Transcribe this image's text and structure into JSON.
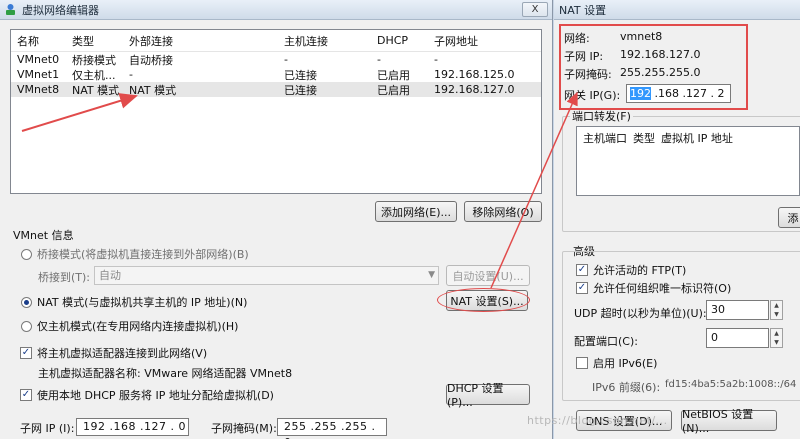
{
  "vne": {
    "title": "虚拟网络编辑器",
    "close_label": "X",
    "list": {
      "headers": [
        "名称",
        "类型",
        "外部连接",
        "主机连接",
        "DHCP",
        "子网地址"
      ],
      "rows": [
        [
          "VMnet0",
          "桥接模式",
          "自动桥接",
          "-",
          "-",
          "-"
        ],
        [
          "VMnet1",
          "仅主机...",
          "-",
          "已连接",
          "已启用",
          "192.168.125.0"
        ],
        [
          "VMnet8",
          "NAT 模式",
          "NAT 模式",
          "已连接",
          "已启用",
          "192.168.127.0"
        ]
      ]
    },
    "add_network": "添加网络(E)...",
    "remove_network": "移除网络(O)",
    "vmnet_info": "VMnet 信息",
    "bridge_mode": "桥接模式(将虚拟机直接连接到外部网络)(B)",
    "bridge_to_label": "桥接到(T):",
    "bridge_to_value": "自动",
    "auto_settings": "自动设置(U)...",
    "nat_mode": "NAT 模式(与虚拟机共享主机的 IP 地址)(N)",
    "nat_settings": "NAT 设置(S)...",
    "host_only_mode": "仅主机模式(在专用网络内连接虚拟机)(H)",
    "connect_adapter": "将主机虚拟适配器连接到此网络(V)",
    "adapter_name": "主机虚拟适配器名称: VMware 网络适配器 VMnet8",
    "use_dhcp": "使用本地 DHCP 服务将 IP 地址分配给虚拟机(D)",
    "dhcp_settings": "DHCP 设置(P)...",
    "subnet_ip_label": "子网 IP (I):",
    "subnet_ip_value": "192 .168 .127 . 0",
    "subnet_mask_label": "子网掩码(M):",
    "subnet_mask_value": "255 .255 .255 . 0"
  },
  "nat": {
    "title": "NAT 设置",
    "network_label": "网络:",
    "network_value": "vmnet8",
    "subnet_ip_label": "子网 IP:",
    "subnet_ip_value": "192.168.127.0",
    "subnet_mask_label": "子网掩码:",
    "subnet_mask_value": "255.255.255.0",
    "gateway_label": "网关 IP(G):",
    "gateway_selected": "192",
    "gateway_rest": " .168 .127 . 2",
    "port_forwarding": "端口转发(F)",
    "port_headers": [
      "主机端口",
      "类型",
      "虚拟机 IP 地址"
    ],
    "add_button": "添",
    "advanced": "高级",
    "allow_ftp": "允许活动的 FTP(T)",
    "allow_any_oui": "允许任何组织唯一标识符(O)",
    "udp_timeout_label": "UDP 超时(以秒为单位)(U):",
    "udp_timeout_value": "30",
    "config_port_label": "配置端口(C):",
    "config_port_value": "0",
    "enable_ipv6": "启用 IPv6(E)",
    "ipv6_prefix_label": "IPv6 前缀(6):",
    "ipv6_prefix_value": "fd15:4ba5:5a2b:1008::/64",
    "dns_settings": "DNS 设置(D)...",
    "netbios_settings": "NetBIOS 设置(N)..."
  },
  "watermark": "https://blog.csdn.net/..."
}
